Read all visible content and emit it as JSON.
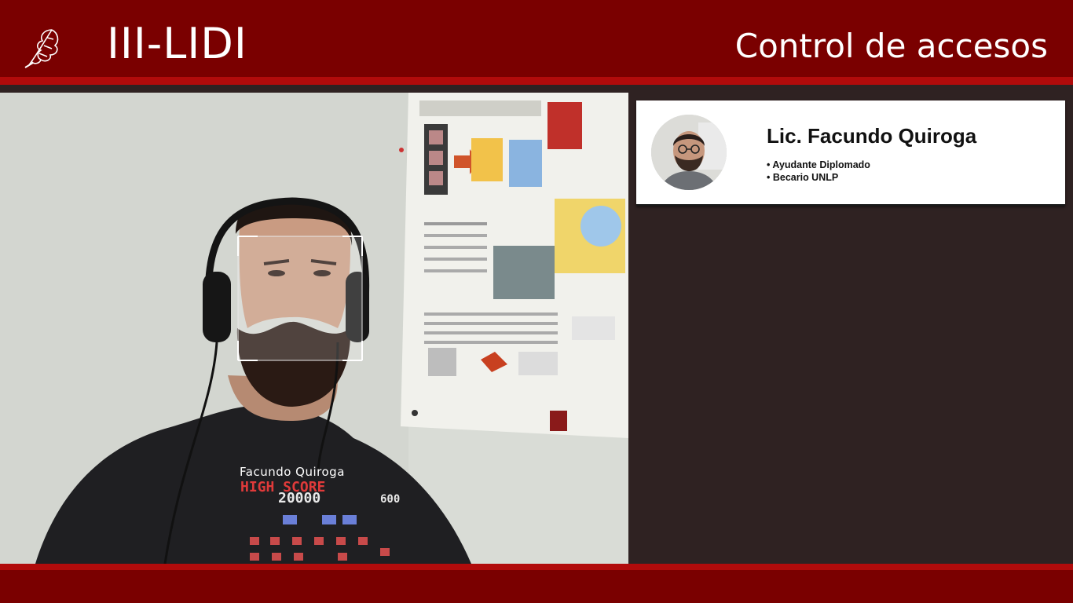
{
  "header": {
    "brand": "III-LIDI",
    "title": "Control de accesos",
    "logo_icon": "oak-leaf-icon"
  },
  "camera": {
    "detected_name": "Facundo Quiroga",
    "shirt_text": {
      "line1": "HIGH SCORE",
      "line2": "20000",
      "side": "600"
    }
  },
  "card": {
    "name": "Lic. Facundo Quiroga",
    "roles": [
      "• Ayudante Diplomado",
      "• Becario UNLP"
    ]
  },
  "colors": {
    "header_bg": "#7a0000",
    "accent_stripe": "#b10b0b",
    "panel_bg": "#2f2222",
    "card_bg": "#ffffff"
  }
}
